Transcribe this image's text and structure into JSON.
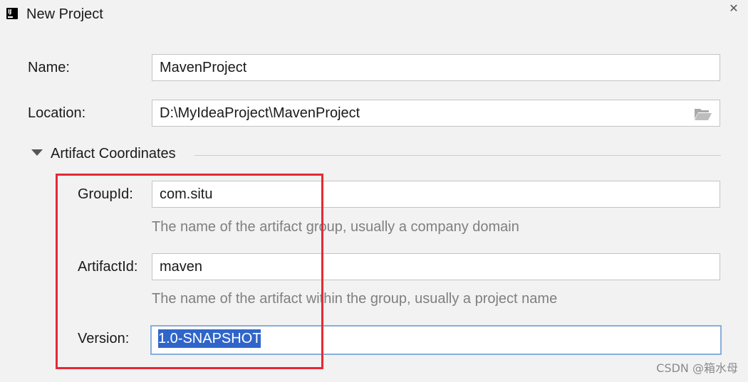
{
  "window": {
    "title": "New Project",
    "close_glyph": "✕",
    "app_icon": "intellij-idea-icon"
  },
  "form": {
    "name": {
      "label": "Name:",
      "value": "MavenProject"
    },
    "location": {
      "label": "Location:",
      "value": "D:\\MyIdeaProject\\MavenProject",
      "browse_icon": "folder-open-icon"
    }
  },
  "artifact_section": {
    "title": "Artifact Coordinates",
    "expanded": true,
    "group_id": {
      "label": "GroupId:",
      "value": "com.situ",
      "hint": "The name of the artifact group, usually a company domain"
    },
    "artifact_id": {
      "label": "ArtifactId:",
      "value": "maven",
      "hint": "The name of the artifact within the group, usually a project name"
    },
    "version": {
      "label": "Version:",
      "value": "1.0-SNAPSHOT",
      "selected": true
    }
  },
  "annotation": {
    "color": "#e52a33"
  },
  "watermark": "CSDN @箱水母"
}
